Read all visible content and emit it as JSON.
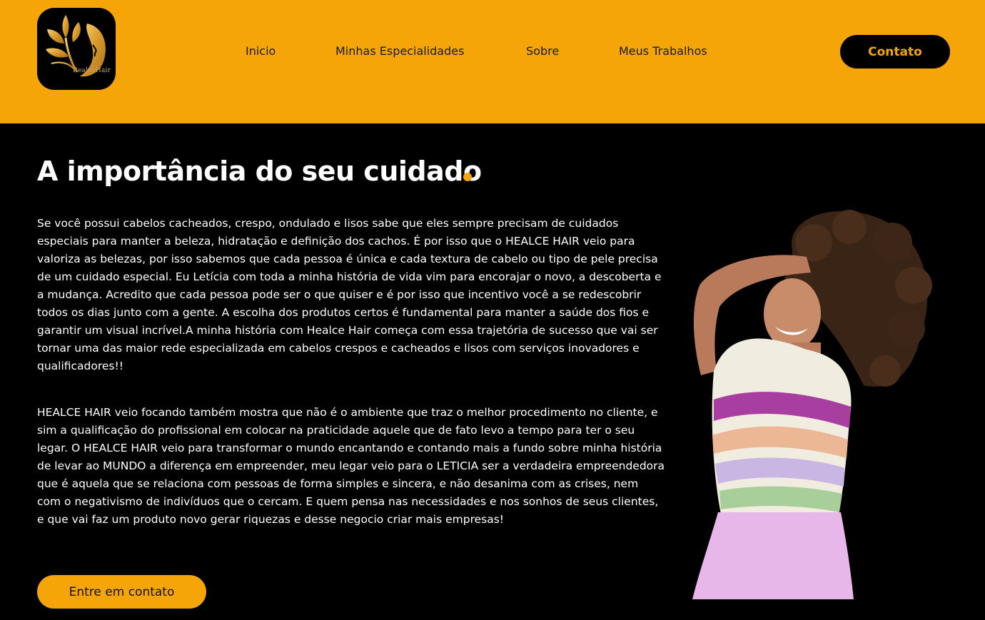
{
  "brand": {
    "logo_text": "RealceHair",
    "accent": "#f5a508"
  },
  "nav": {
    "items": [
      {
        "label": "Inicio"
      },
      {
        "label": "Minhas Especialidades"
      },
      {
        "label": "Sobre"
      },
      {
        "label": "Meus Trabalhos"
      }
    ],
    "cta_label": "Contato"
  },
  "main": {
    "title": "A importância do seu cuidado",
    "paragraph1": "Se você possui cabelos cacheados, crespo, ondulado e lisos sabe que eles sempre precisam de cuidados especiais para manter a beleza, hidratação e definição dos cachos. É por isso que o HEALCE HAIR veio para valoriza as belezas, por isso sabemos que cada pessoa é única e cada textura de cabelo ou tipo de pele precisa de um cuidado especial. Eu Letícia com toda a minha história de vida vim para encorajar o novo, a descoberta e a mudança. Acredito que cada pessoa pode ser o que quiser e é por isso que incentivo você a se redescobrir todos os dias junto com a gente. A escolha dos produtos certos é fundamental para manter a saúde dos fios e garantir um visual incrível.A minha história com Healce Hair começa com essa trajetória de sucesso que vai ser tornar uma das maior rede especializada em cabelos crespos e cacheados e lisos com serviços inovadores e qualificadores!!",
    "paragraph2": "HEALCE HAIR veio focando também mostra que não é o ambiente que traz o melhor procedimento no cliente, e sim a qualificação do profissional em colocar na praticidade aquele que de fato levo a tempo para ter o seu legar. O HEALCE HAIR veio para transformar o mundo encantando e contando mais a fundo sobre minha história de levar ao MUNDO a diferença em empreender, meu legar veio para o LETICIA ser a verdadeira empreendedora que é aquela que se relaciona com pessoas de forma simples e sincera, e não desanima com as crises, nem com o negativismo de indivíduos que o cercam. E quem pensa nas necessidades e nos sonhos de seus clientes, e que vai faz um produto novo gerar riquezas e desse negocio criar mais empresas!",
    "cta_label": "Entre em contato"
  }
}
